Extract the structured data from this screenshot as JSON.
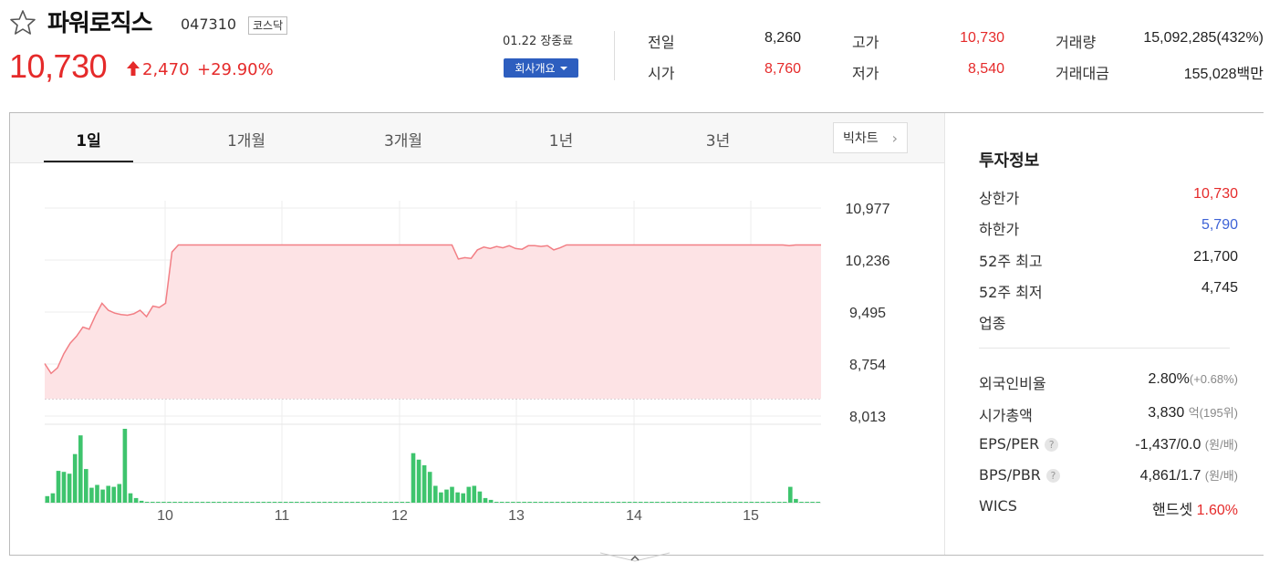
{
  "header": {
    "name": "파워로직스",
    "code": "047310",
    "market": "코스닥",
    "price": "10,730",
    "change": "2,470",
    "change_pct": "+29.90%",
    "status": "01.22 장종료",
    "company_btn": "회사개요"
  },
  "summary": [
    {
      "label": "전일",
      "value": "8,260",
      "color": "dark"
    },
    {
      "label": "고가",
      "value": "10,730",
      "color": "red"
    },
    {
      "label": "거래량",
      "value": "15,092,285(432%)",
      "color": "dark"
    },
    {
      "label": "시가",
      "value": "8,760",
      "color": "red"
    },
    {
      "label": "저가",
      "value": "8,540",
      "color": "red"
    },
    {
      "label": "거래대금",
      "value": "155,028백만",
      "color": "dark"
    }
  ],
  "tabs": [
    "1일",
    "1개월",
    "3개월",
    "1년",
    "3년"
  ],
  "bigchart_label": "빅차트",
  "info": {
    "title": "투자정보",
    "rows": [
      {
        "label": "상한가",
        "value": "10,730",
        "color": "red"
      },
      {
        "label": "하한가",
        "value": "5,790",
        "color": "blue"
      },
      {
        "label": "52주 최고",
        "value": "21,700",
        "color": "dark"
      },
      {
        "label": "52주 최저",
        "value": "4,745",
        "color": "dark"
      },
      {
        "label": "업종",
        "value": "",
        "color": "dark"
      }
    ],
    "rows2": [
      {
        "label": "외국인비율",
        "value": "2.80%",
        "sub": "(+0.68%)",
        "color": "dark",
        "help": false
      },
      {
        "label": "시가총액",
        "value": "3,830",
        "sub": "억(195위)",
        "color": "dark",
        "help": false
      },
      {
        "label": "EPS/PER",
        "value": "-1,437/0.0",
        "sub": "(원/배)",
        "color": "dark",
        "help": true
      },
      {
        "label": "BPS/PBR",
        "value": "4,861/1.7",
        "sub": "(원/배)",
        "color": "dark",
        "help": true
      },
      {
        "label": "WICS",
        "value": "핸드셋",
        "sub": "1.60%",
        "color": "dark",
        "help": false
      }
    ]
  },
  "colors": {
    "up": "#e52a2a",
    "down": "#3d62d6",
    "volume": "#3ec46d",
    "fill": "#fde3e5"
  },
  "chart_data": {
    "type": "line",
    "x_ticks": [
      "10",
      "11",
      "12",
      "13",
      "14",
      "15"
    ],
    "y_ticks": [
      "10,977",
      "10,236",
      "9,495",
      "8,754",
      "8,013"
    ],
    "ylim": [
      8013,
      10977
    ],
    "prev_close": 8260,
    "price_series": [
      8760,
      8620,
      8700,
      8900,
      9050,
      9150,
      9280,
      9250,
      9450,
      9620,
      9520,
      9480,
      9460,
      9450,
      9470,
      9520,
      9430,
      9580,
      9560,
      9620,
      10350,
      10450,
      10450,
      10450,
      10450,
      10450,
      10450,
      10450,
      10450,
      10450,
      10450,
      10450,
      10450,
      10450,
      10450,
      10450,
      10450,
      10450,
      10450,
      10450,
      10450,
      10450,
      10450,
      10450,
      10450,
      10450,
      10450,
      10450,
      10450,
      10450,
      10450,
      10450,
      10450,
      10450,
      10450,
      10450,
      10450,
      10450,
      10450,
      10450,
      10450,
      10450,
      10450,
      10450,
      10450,
      10250,
      10270,
      10260,
      10380,
      10420,
      10400,
      10430,
      10410,
      10440,
      10400,
      10390,
      10440,
      10440,
      10430,
      10440,
      10380,
      10410,
      10450,
      10450,
      10450,
      10450,
      10450,
      10450,
      10450,
      10450,
      10450,
      10450,
      10450,
      10450,
      10450,
      10450,
      10450,
      10450,
      10450,
      10450,
      10450,
      10450,
      10450,
      10450,
      10450,
      10450,
      10450,
      10450,
      10450,
      10450,
      10450,
      10450,
      10450,
      10450,
      10450,
      10450,
      10450,
      10440,
      10450,
      10450,
      10450,
      10450,
      10450
    ],
    "volume_series": [
      7,
      10,
      34,
      33,
      31,
      52,
      72,
      36,
      16,
      19,
      14,
      18,
      17,
      20,
      79,
      10,
      5,
      2,
      1,
      1,
      1,
      1,
      1,
      1,
      1,
      1,
      1,
      1,
      1,
      1,
      1,
      1,
      1,
      1,
      1,
      1,
      1,
      1,
      1,
      1,
      1,
      1,
      1,
      1,
      1,
      1,
      1,
      1,
      1,
      1,
      1,
      1,
      1,
      1,
      1,
      1,
      1,
      1,
      1,
      1,
      1,
      1,
      1,
      1,
      1,
      1,
      53,
      46,
      40,
      33,
      18,
      11,
      14,
      17,
      11,
      10,
      17,
      18,
      12,
      5,
      3,
      1,
      1,
      1,
      1,
      1,
      1,
      1,
      1,
      1,
      1,
      1,
      1,
      1,
      1,
      1,
      1,
      1,
      1,
      1,
      1,
      1,
      1,
      1,
      1,
      1,
      1,
      1,
      1,
      1,
      1,
      1,
      1,
      1,
      1,
      1,
      1,
      1,
      1,
      1,
      1,
      1,
      1,
      1,
      1,
      1,
      1,
      1,
      1,
      1,
      1,
      1,
      1,
      1,
      17,
      4,
      1,
      1,
      1,
      1
    ]
  }
}
